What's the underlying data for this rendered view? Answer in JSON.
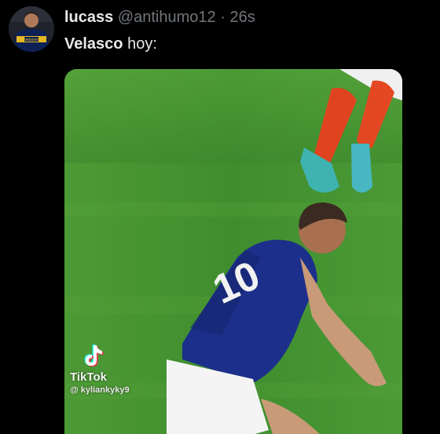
{
  "tweet": {
    "display_name": "lucass",
    "handle": "@antihumo12",
    "separator": "·",
    "time": "26s",
    "text_bold": "Velasco",
    "text_rest": " hoy:"
  },
  "media": {
    "type": "video",
    "watermark": {
      "brand": "TikTok",
      "user": "@ kyliankyky9"
    }
  },
  "colors": {
    "background": "#000000",
    "primary_text": "#e7e9ea",
    "secondary_text": "#71767b",
    "pitch_green": "#3f8d2e",
    "jersey_blue": "#1c2f8a"
  }
}
